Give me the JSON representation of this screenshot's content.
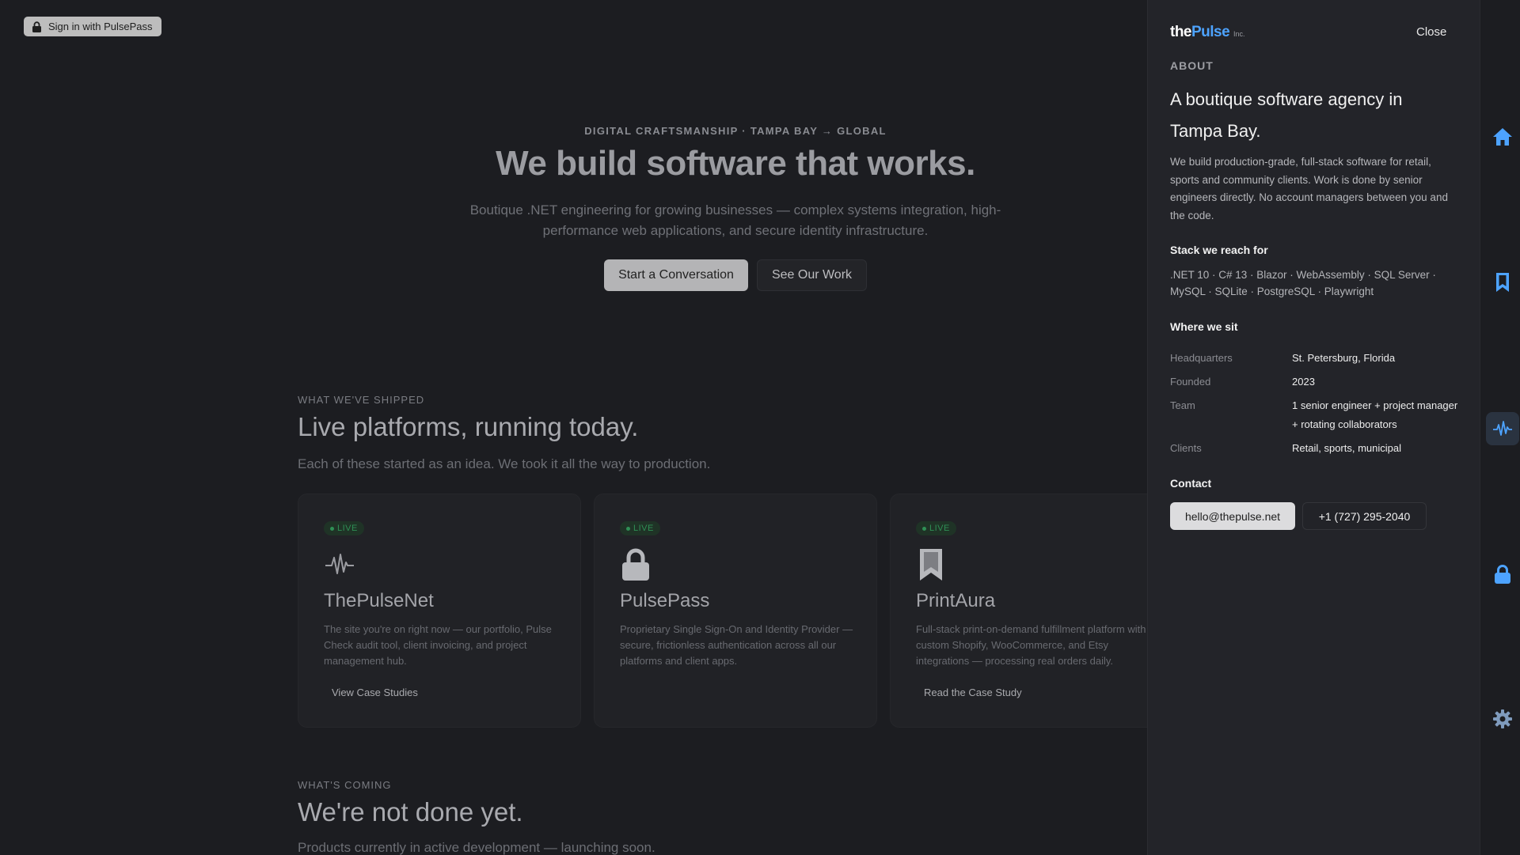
{
  "signin": {
    "label": "Sign in with PulsePass"
  },
  "hero": {
    "eyebrow": "DIGITAL CRAFTSMANSHIP · TAMPA BAY → GLOBAL",
    "title": "We build software that works.",
    "lead": "Boutique .NET engineering for growing businesses — complex systems integration, high-performance web applications, and secure identity infrastructure.",
    "primary_cta": "Start a Conversation",
    "secondary_cta": "See Our Work"
  },
  "shipped": {
    "eyebrow": "WHAT WE'VE SHIPPED",
    "title": "Live platforms, running today.",
    "subtitle": "Each of these started as an idea. We took it all the way to production.",
    "cards": [
      {
        "badge": "LIVE",
        "icon": "pulse-icon",
        "name": "ThePulseNet",
        "description": "The site you're on right now — our portfolio, Pulse Check audit tool, client invoicing, and project management hub.",
        "link": "View Case Studies"
      },
      {
        "badge": "LIVE",
        "icon": "lock-icon",
        "name": "PulsePass",
        "description": "Proprietary Single Sign-On and Identity Provider — secure, frictionless authentication across all our platforms and client apps.",
        "link": ""
      },
      {
        "badge": "LIVE",
        "icon": "bookmark-icon",
        "name": "PrintAura",
        "description": "Full-stack print-on-demand fulfillment platform with custom Shopify, WooCommerce, and Etsy integrations — processing real orders daily.",
        "link": "Read the Case Study"
      }
    ]
  },
  "coming": {
    "eyebrow": "WHAT'S COMING",
    "title": "We're not done yet.",
    "subtitle": "Products currently in active development — launching soon."
  },
  "panel": {
    "logo_the": "the",
    "logo_pulse": "Pulse",
    "logo_inc": "Inc.",
    "close_label": "Close",
    "section_label": "ABOUT",
    "title": "A boutique software agency in Tampa Bay.",
    "body": "We build production-grade, full-stack software for retail, sports and community clients. Work is done by senior engineers directly. No account managers between you and the code.",
    "stack_heading": "Stack we reach for",
    "stack": ".NET 10 · C# 13 · Blazor · WebAssembly · SQL Server · MySQL · SQLite · PostgreSQL · Playwright",
    "where_heading": "Where we sit",
    "facts": [
      {
        "key": "Headquarters",
        "value": "St. Petersburg, Florida"
      },
      {
        "key": "Founded",
        "value": "2023"
      },
      {
        "key": "Team",
        "value": "1 senior engineer + project manager + rotating collaborators"
      },
      {
        "key": "Clients",
        "value": "Retail, sports, municipal"
      }
    ],
    "contact_heading": "Contact",
    "email": "hello@thepulse.net",
    "phone": "+1 (727) 295-2040"
  },
  "dock": {
    "items": [
      "home-icon",
      "bookmark-icon",
      "pulse-icon",
      "lock-icon",
      "gear-icon"
    ],
    "active": "pulse-icon",
    "accent": "#4da3ff"
  }
}
